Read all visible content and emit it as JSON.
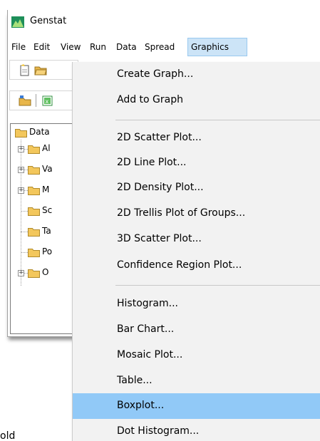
{
  "window": {
    "title": "Genstat"
  },
  "menubar": {
    "items": [
      {
        "label": "File"
      },
      {
        "label": "Edit"
      },
      {
        "label": "View"
      },
      {
        "label": "Run"
      },
      {
        "label": "Data"
      },
      {
        "label": "Spread"
      },
      {
        "label": "Graphics",
        "active": true
      }
    ]
  },
  "tree": {
    "root": "Data",
    "children": [
      "Al",
      "Va",
      "M",
      "Sc",
      "Ta",
      "Po",
      "O"
    ]
  },
  "graphics_menu": {
    "groups": [
      [
        "Create Graph...",
        "Add to Graph"
      ],
      [
        "2D Scatter Plot...",
        "2D Line Plot...",
        "2D Density Plot...",
        "2D Trellis Plot of Groups...",
        "3D Scatter Plot...",
        "Confidence Region Plot..."
      ],
      [
        "Histogram...",
        "Bar Chart...",
        "Mosaic Plot...",
        "Table...",
        "Boxplot...",
        "Dot Histogram..."
      ]
    ],
    "highlighted": "Boxplot..."
  },
  "background_text": "old",
  "colors": {
    "menu_bg": "#f2f2f2",
    "highlight": "#91c9f7",
    "active_menu": "#cce4f7"
  }
}
